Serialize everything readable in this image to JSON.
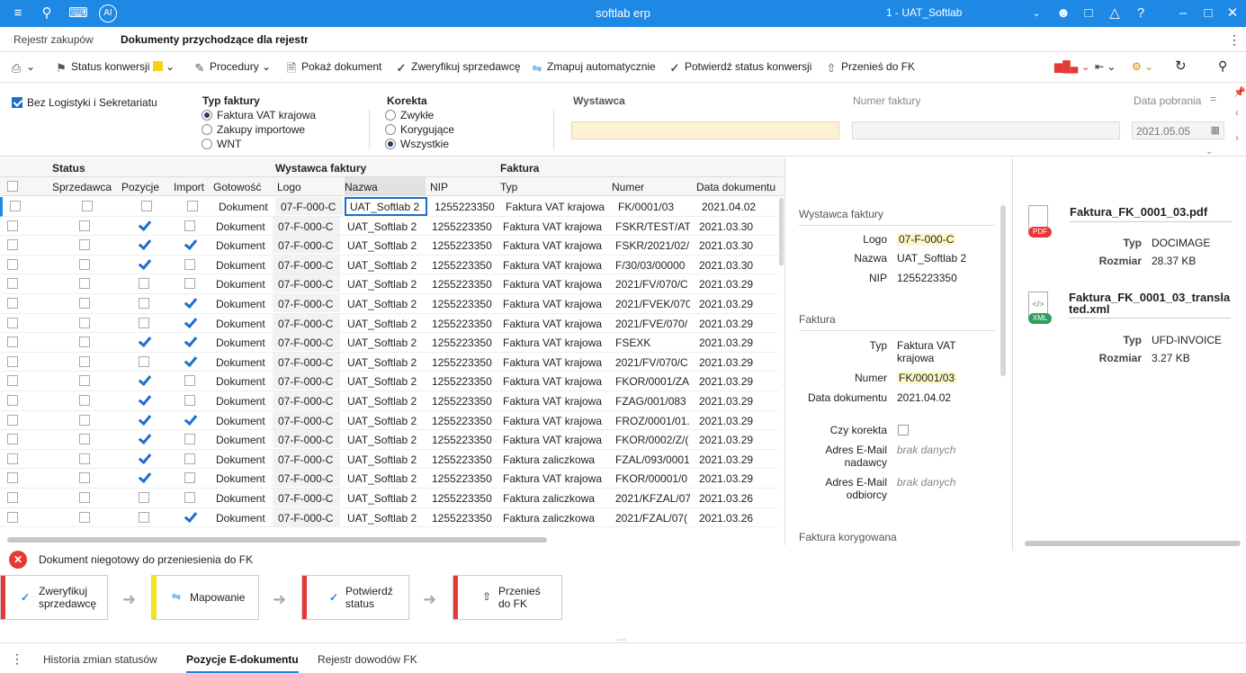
{
  "titlebar": {
    "app_name": "softlab erp",
    "company": "1 - UAT_Softlab"
  },
  "tabs": [
    {
      "label": "Rejestr zakupów"
    },
    {
      "label": "Dokumenty przychodzące dla rejestru"
    }
  ],
  "toolbar": {
    "status_konwersji": "Status konwersji",
    "procedury": "Procedury",
    "pokaz_dokument": "Pokaż dokument",
    "zweryfikuj": "Zweryfikuj sprzedawcę",
    "zmapuj": "Zmapuj automatycznie",
    "potwierdz": "Potwierdź status konwersji",
    "przenies": "Przenieś do FK"
  },
  "filter": {
    "bez_logistyki": "Bez Logistyki i Sekretariatu",
    "typ_faktury_label": "Typ faktury",
    "typ_faktury_options": [
      "Faktura VAT krajowa",
      "Zakupy importowe",
      "WNT"
    ],
    "korekta_label": "Korekta",
    "korekta_options": [
      "Zwykłe",
      "Korygujące",
      "Wszystkie"
    ],
    "wystawca_label": "Wystawca",
    "numer_faktury_label": "Numer faktury",
    "data_pobrania_label": "Data pobrania",
    "data_pobrania_value": "2021.05.05"
  },
  "grid": {
    "group_headers": {
      "status": "Status",
      "wystawca": "Wystawca faktury",
      "faktura": "Faktura"
    },
    "columns": [
      "Sprzedawca",
      "Pozycje",
      "Import",
      "Gotowość",
      "Logo",
      "Nazwa",
      "NIP",
      "Typ",
      "Numer",
      "Data dokumentu"
    ],
    "rows": [
      {
        "sprzedawca": false,
        "pozycje": false,
        "import": false,
        "gotowosc": "Dokument",
        "logo": "07-F-000-C",
        "nazwa": "UAT_Softlab 2",
        "nip": "1255223350",
        "typ": "Faktura VAT krajowa",
        "numer": "FK/0001/03",
        "data": "2021.04.02"
      },
      {
        "sprzedawca": false,
        "pozycje": true,
        "import": false,
        "gotowosc": "Dokument",
        "logo": "07-F-000-C",
        "nazwa": "UAT_Softlab 2",
        "nip": "1255223350",
        "typ": "Faktura VAT krajowa",
        "numer": "FSKR/TEST/AT",
        "data": "2021.03.30"
      },
      {
        "sprzedawca": false,
        "pozycje": true,
        "import": true,
        "gotowosc": "Dokument",
        "logo": "07-F-000-C",
        "nazwa": "UAT_Softlab 2",
        "nip": "1255223350",
        "typ": "Faktura VAT krajowa",
        "numer": "FSKR/2021/02/",
        "data": "2021.03.30"
      },
      {
        "sprzedawca": false,
        "pozycje": true,
        "import": false,
        "gotowosc": "Dokument",
        "logo": "07-F-000-C",
        "nazwa": "UAT_Softlab 2",
        "nip": "1255223350",
        "typ": "Faktura VAT krajowa",
        "numer": "F/30/03/00000",
        "data": "2021.03.30"
      },
      {
        "sprzedawca": false,
        "pozycje": false,
        "import": false,
        "gotowosc": "Dokument",
        "logo": "07-F-000-C",
        "nazwa": "UAT_Softlab 2",
        "nip": "1255223350",
        "typ": "Faktura VAT krajowa",
        "numer": "2021/FV/070/C",
        "data": "2021.03.29"
      },
      {
        "sprzedawca": false,
        "pozycje": false,
        "import": true,
        "gotowosc": "Dokument",
        "logo": "07-F-000-C",
        "nazwa": "UAT_Softlab 2",
        "nip": "1255223350",
        "typ": "Faktura VAT krajowa",
        "numer": "2021/FVEK/070",
        "data": "2021.03.29"
      },
      {
        "sprzedawca": false,
        "pozycje": false,
        "import": true,
        "gotowosc": "Dokument",
        "logo": "07-F-000-C",
        "nazwa": "UAT_Softlab 2",
        "nip": "1255223350",
        "typ": "Faktura VAT krajowa",
        "numer": "2021/FVE/070/",
        "data": "2021.03.29"
      },
      {
        "sprzedawca": false,
        "pozycje": true,
        "import": true,
        "gotowosc": "Dokument",
        "logo": "07-F-000-C",
        "nazwa": "UAT_Softlab 2",
        "nip": "1255223350",
        "typ": "Faktura VAT krajowa",
        "numer": "FSEXK",
        "data": "2021.03.29"
      },
      {
        "sprzedawca": false,
        "pozycje": false,
        "import": true,
        "gotowosc": "Dokument",
        "logo": "07-F-000-C",
        "nazwa": "UAT_Softlab 2",
        "nip": "1255223350",
        "typ": "Faktura VAT krajowa",
        "numer": "2021/FV/070/C",
        "data": "2021.03.29"
      },
      {
        "sprzedawca": false,
        "pozycje": true,
        "import": false,
        "gotowosc": "Dokument",
        "logo": "07-F-000-C",
        "nazwa": "UAT_Softlab 2",
        "nip": "1255223350",
        "typ": "Faktura VAT krajowa",
        "numer": "FKOR/0001/ZA",
        "data": "2021.03.29"
      },
      {
        "sprzedawca": false,
        "pozycje": true,
        "import": false,
        "gotowosc": "Dokument",
        "logo": "07-F-000-C",
        "nazwa": "UAT_Softlab 2",
        "nip": "1255223350",
        "typ": "Faktura VAT krajowa",
        "numer": "FZAG/001/083",
        "data": "2021.03.29"
      },
      {
        "sprzedawca": false,
        "pozycje": true,
        "import": true,
        "gotowosc": "Dokument",
        "logo": "07-F-000-C",
        "nazwa": "UAT_Softlab 2",
        "nip": "1255223350",
        "typ": "Faktura VAT krajowa",
        "numer": "FROZ/0001/01.",
        "data": "2021.03.29"
      },
      {
        "sprzedawca": false,
        "pozycje": true,
        "import": false,
        "gotowosc": "Dokument",
        "logo": "07-F-000-C",
        "nazwa": "UAT_Softlab 2",
        "nip": "1255223350",
        "typ": "Faktura VAT krajowa",
        "numer": "FKOR/0002/Z/(",
        "data": "2021.03.29"
      },
      {
        "sprzedawca": false,
        "pozycje": true,
        "import": false,
        "gotowosc": "Dokument",
        "logo": "07-F-000-C",
        "nazwa": "UAT_Softlab 2",
        "nip": "1255223350",
        "typ": "Faktura zaliczkowa",
        "numer": "FZAL/093/0001",
        "data": "2021.03.29"
      },
      {
        "sprzedawca": false,
        "pozycje": true,
        "import": false,
        "gotowosc": "Dokument",
        "logo": "07-F-000-C",
        "nazwa": "UAT_Softlab 2",
        "nip": "1255223350",
        "typ": "Faktura VAT krajowa",
        "numer": "FKOR/00001/0",
        "data": "2021.03.29"
      },
      {
        "sprzedawca": false,
        "pozycje": false,
        "import": false,
        "gotowosc": "Dokument",
        "logo": "07-F-000-C",
        "nazwa": "UAT_Softlab 2",
        "nip": "1255223350",
        "typ": "Faktura zaliczkowa",
        "numer": "2021/KFZAL/07",
        "data": "2021.03.26"
      },
      {
        "sprzedawca": false,
        "pozycje": false,
        "import": true,
        "gotowosc": "Dokument",
        "logo": "07-F-000-C",
        "nazwa": "UAT_Softlab 2",
        "nip": "1255223350",
        "typ": "Faktura zaliczkowa",
        "numer": "2021/FZAL/07(",
        "data": "2021.03.26"
      }
    ]
  },
  "details": {
    "wystawca_section": "Wystawca faktury",
    "logo_label": "Logo",
    "logo_value": "07-F-000-C",
    "nazwa_label": "Nazwa",
    "nazwa_value": "UAT_Softlab 2",
    "nip_label": "NIP",
    "nip_value": "1255223350",
    "faktura_section": "Faktura",
    "typ_label": "Typ",
    "typ_value": "Faktura VAT krajowa",
    "numer_label": "Numer",
    "numer_value": "FK/0001/03",
    "data_label": "Data dokumentu",
    "data_value": "2021.04.02",
    "korekta_label": "Czy korekta",
    "email_nadawcy_label": "Adres E-Mail nadawcy",
    "email_nadawcy_value": "brak danych",
    "email_odbiorcy_label": "Adres E-Mail odbiorcy",
    "email_odbiorcy_value": "brak danych",
    "korygowana_section": "Faktura korygowana"
  },
  "attachments": [
    {
      "name": "Faktura_FK_0001_03.pdf",
      "badge": "PDF",
      "typ_label": "Typ",
      "typ": "DOCIMAGE",
      "rozmiar_label": "Rozmiar",
      "rozmiar": "28.37 KB"
    },
    {
      "name": "Faktura_FK_0001_03_translated.xml",
      "badge": "XML",
      "typ_label": "Typ",
      "typ": "UFD-INVOICE",
      "rozmiar_label": "Rozmiar",
      "rozmiar": "3.27 KB"
    }
  ],
  "status_message": "Dokument niegotowy do przeniesienia do FK",
  "steps": [
    {
      "label": "Zweryfikuj sprzedawcę",
      "color": "#e53935"
    },
    {
      "label": "Mapowanie",
      "color": "#f4e21a"
    },
    {
      "label": "Potwierdź status",
      "color": "#e53935"
    },
    {
      "label": "Przenieś do FK",
      "color": "#e53935"
    }
  ],
  "bottom_tabs": [
    "Historia zmian statusów",
    "Pozycje E-dokumentu",
    "Rejestr dowodów FK"
  ]
}
